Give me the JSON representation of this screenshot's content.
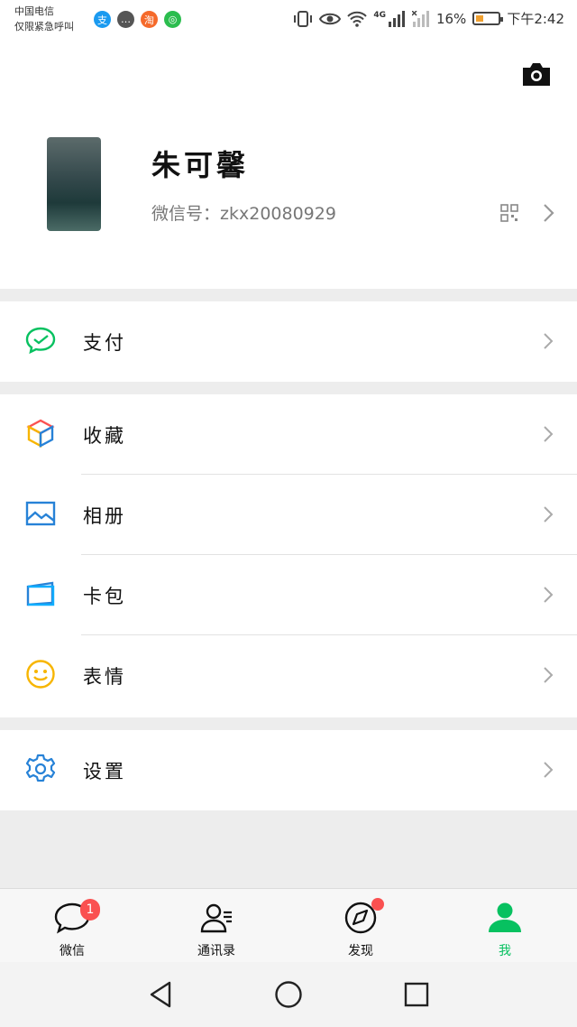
{
  "status_bar": {
    "carrier_line1": "中国电信",
    "carrier_line2": "仅限紧急呼叫",
    "network": "4G",
    "battery": "16%",
    "time": "下午2:42",
    "notification_icons": [
      "alipay-icon",
      "chat-bubble-icon",
      "taobao-icon",
      "app-icon"
    ]
  },
  "profile": {
    "name": "朱可馨",
    "wechat_id_label": "微信号：",
    "wechat_id": "zkx20080929"
  },
  "menu": {
    "pay": "支付",
    "favorites": "收藏",
    "album": "相册",
    "cards": "卡包",
    "stickers": "表情",
    "settings": "设置"
  },
  "tabs": {
    "chats": "微信",
    "contacts": "通讯录",
    "discover": "发现",
    "me": "我",
    "chats_badge": "1"
  },
  "colors": {
    "accent": "#07c160",
    "badge": "#fa5151",
    "divider": "#e2e2e2",
    "background": "#ededed"
  }
}
